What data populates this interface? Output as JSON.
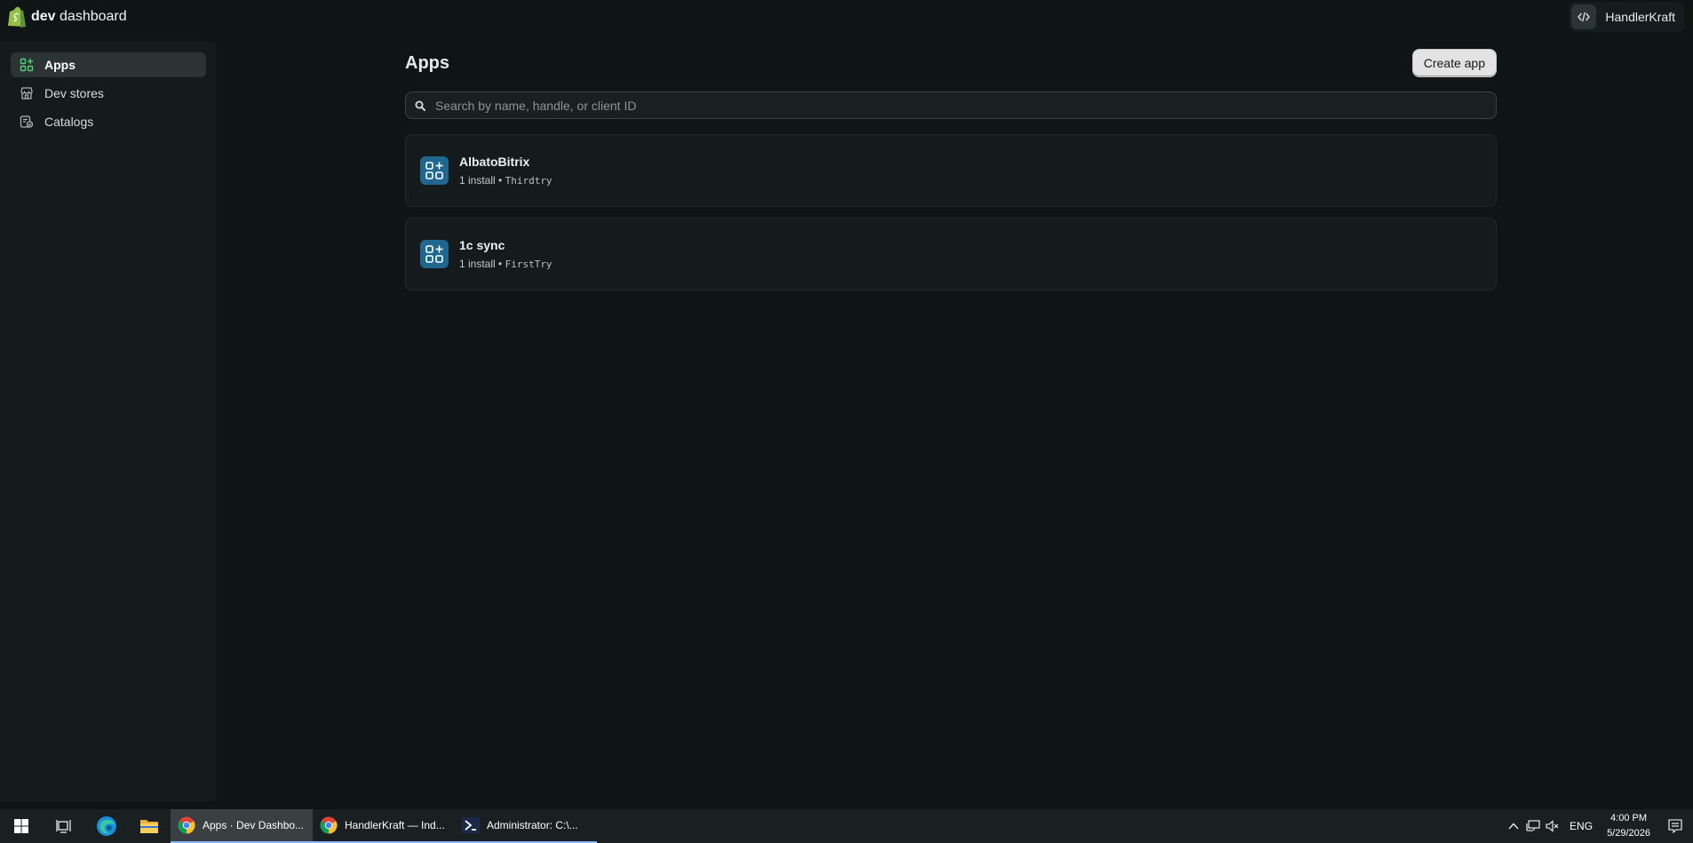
{
  "brand": {
    "bold": "dev",
    "rest": " dashboard"
  },
  "account": {
    "name": "HandlerKraft",
    "icon": "code-icon"
  },
  "sidebar": {
    "items": [
      {
        "label": "Apps",
        "icon": "apps-icon",
        "active": true
      },
      {
        "label": "Dev stores",
        "icon": "store-icon",
        "active": false
      },
      {
        "label": "Catalogs",
        "icon": "catalog-icon",
        "active": false
      }
    ]
  },
  "main": {
    "title": "Apps",
    "create_button": "Create app",
    "search": {
      "placeholder": "Search by name, handle, or client ID",
      "value": ""
    },
    "apps": [
      {
        "name": "AlbatoBitrix",
        "installs": "1 install",
        "separator": "•",
        "handle": "Thirdtry"
      },
      {
        "name": "1c sync",
        "installs": "1 install",
        "separator": "•",
        "handle": "FirstTry"
      }
    ]
  },
  "taskbar": {
    "windows": [
      {
        "label": "Apps · Dev Dashbo...",
        "icon": "chrome-icon",
        "state": "active"
      },
      {
        "label": "HandlerKraft — Ind...",
        "icon": "chrome-icon",
        "state": "open"
      },
      {
        "label": "Administrator:  C:\\...",
        "icon": "powershell-icon",
        "state": "open"
      }
    ],
    "language": "ENG",
    "time": "4:00 PM",
    "date": "5/29/2026"
  },
  "colors": {
    "background": "#0f1415",
    "sidebar": "#151b1d",
    "accent_green": "#95bf47",
    "app_icon_blue": "#1f6790",
    "taskbar": "#1a1f21"
  }
}
